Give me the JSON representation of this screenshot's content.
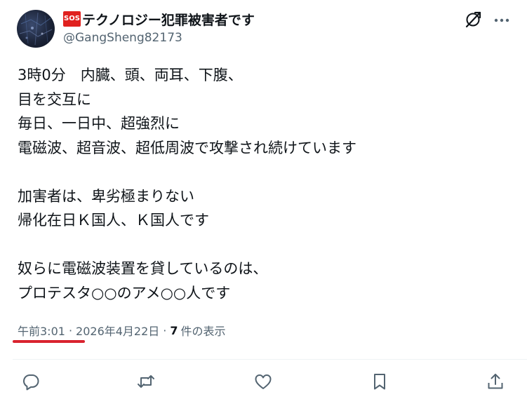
{
  "author": {
    "display_name": "テクノロジー犯罪被害者です",
    "emoji_badge": "SOS",
    "handle": "@GangSheng82173",
    "avatar_icon": "profile-photo-icon"
  },
  "body_lines": [
    "3時0分　内臓、頭、両耳、下腹、",
    "目を交互に",
    "毎日、一日中、超強烈に",
    "電磁波、超音波、超低周波で攻撃され続けています",
    "",
    "加害者は、卑劣極まりない",
    "帰化在日Ｋ国人、Ｋ国人です",
    "",
    "奴らに電磁波装置を貸しているのは、",
    "プロテスタ○○のアメ○○人です"
  ],
  "meta": {
    "time": "午前3:01",
    "separator": "·",
    "date": "2026年4月22日",
    "views_count": "7",
    "views_label": "件の表示"
  },
  "colors": {
    "text": "#0f1419",
    "secondary": "#536471",
    "sos_red": "#e0211f",
    "underline_red": "#d9232f",
    "divider": "#eff3f4"
  },
  "actions": [
    "reply-icon",
    "retweet-icon",
    "like-icon",
    "bookmark-icon",
    "share-icon"
  ]
}
